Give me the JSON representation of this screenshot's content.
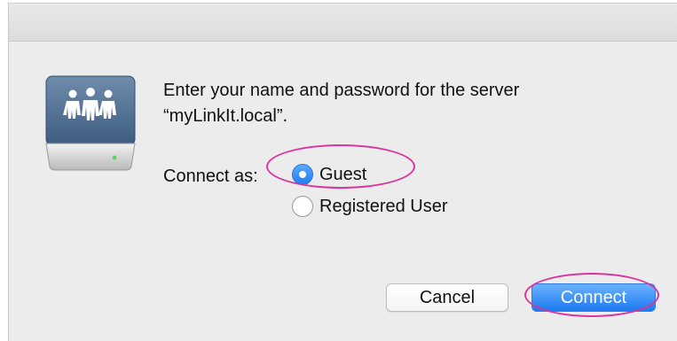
{
  "dialog": {
    "message_line1": "Enter your name and password for the server",
    "message_line2": "“myLinkIt.local”.",
    "icon": "shared-server-drive-icon",
    "connect_as": {
      "label": "Connect as:",
      "options": [
        {
          "label": "Guest",
          "selected": true
        },
        {
          "label": "Registered User",
          "selected": false
        }
      ]
    },
    "buttons": {
      "cancel_label": "Cancel",
      "connect_label": "Connect"
    },
    "colors": {
      "accent": "#1f7ef2",
      "annotation": "#d9359c"
    }
  }
}
